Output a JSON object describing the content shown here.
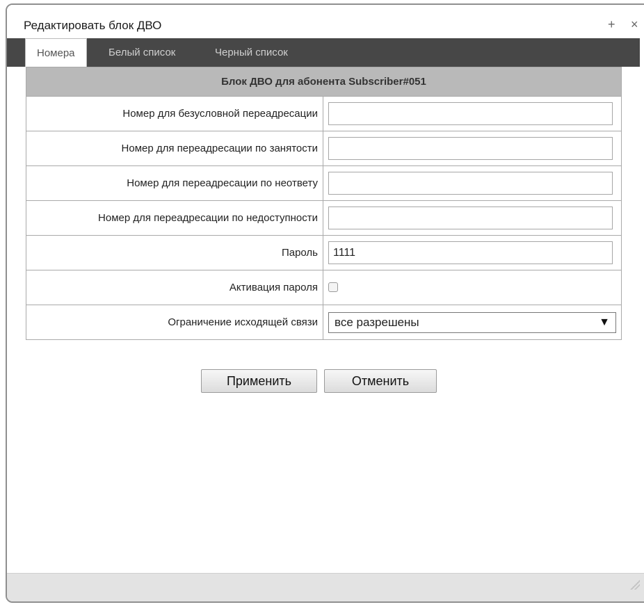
{
  "dialog": {
    "title": "Редактировать блок ДВО",
    "add_icon": "+",
    "close_icon": "×"
  },
  "tabs": [
    {
      "label": "Номера",
      "active": true
    },
    {
      "label": "Белый список",
      "active": false
    },
    {
      "label": "Черный список",
      "active": false
    }
  ],
  "form": {
    "header": "Блок ДВО для абонента Subscriber#051",
    "rows": [
      {
        "label": "Номер для безусловной переадресации",
        "value": ""
      },
      {
        "label": "Номер для переадресации по занятости",
        "value": ""
      },
      {
        "label": "Номер для переадресации по неответу",
        "value": ""
      },
      {
        "label": "Номер для переадресации по недоступности",
        "value": ""
      },
      {
        "label": "Пароль",
        "value": "1111"
      }
    ],
    "password_activation": {
      "label": "Активация пароля",
      "checked": false
    },
    "outgoing_restriction": {
      "label": "Ограничение исходящей связи",
      "selected": "все разрешены",
      "arrow": "▼"
    }
  },
  "buttons": {
    "apply": "Применить",
    "cancel": "Отменить"
  }
}
